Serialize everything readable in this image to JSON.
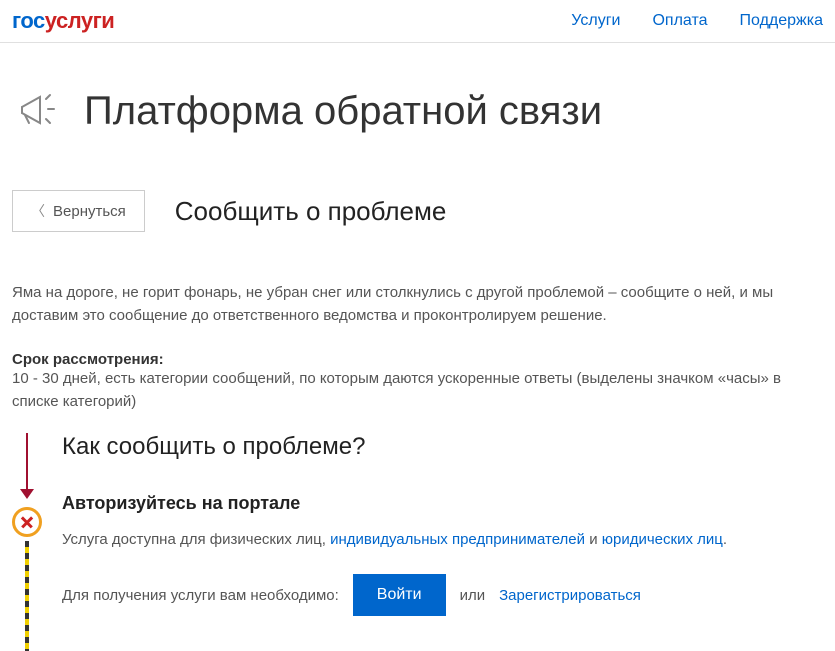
{
  "header": {
    "logo": {
      "part1": "гос",
      "part2": "услуги"
    },
    "nav": [
      "Услуги",
      "Оплата",
      "Поддержка"
    ]
  },
  "platform": {
    "title": "Платформа обратной связи"
  },
  "back_button": "Вернуться",
  "section_title": "Сообщить о проблеме",
  "description": "Яма на дороге, не горит фонарь, не убран снег или столкнулись с другой проблемой – сообщите о ней, и мы доставим это сообщение до ответственного ведомства и проконтролируем решение.",
  "term": {
    "label": "Срок рассмотрения:",
    "value": "10 - 30 дней, есть категории сообщений, по которым даются ускоренные ответы (выделены значком «часы» в списке категорий)"
  },
  "how": {
    "title": "Как сообщить о проблеме?",
    "step1": {
      "title": "Авторизуйтесь на портале",
      "text_before": "Услуга доступна для физических лиц, ",
      "link1": "индивидуальных предпринимателей",
      "text_middle": " и ",
      "link2": "юридических лиц",
      "text_after": ".",
      "login_intro": "Для получения услуги вам необходимо:",
      "login_button": "Войти",
      "or": "или",
      "register": "Зарегистрироваться"
    }
  }
}
